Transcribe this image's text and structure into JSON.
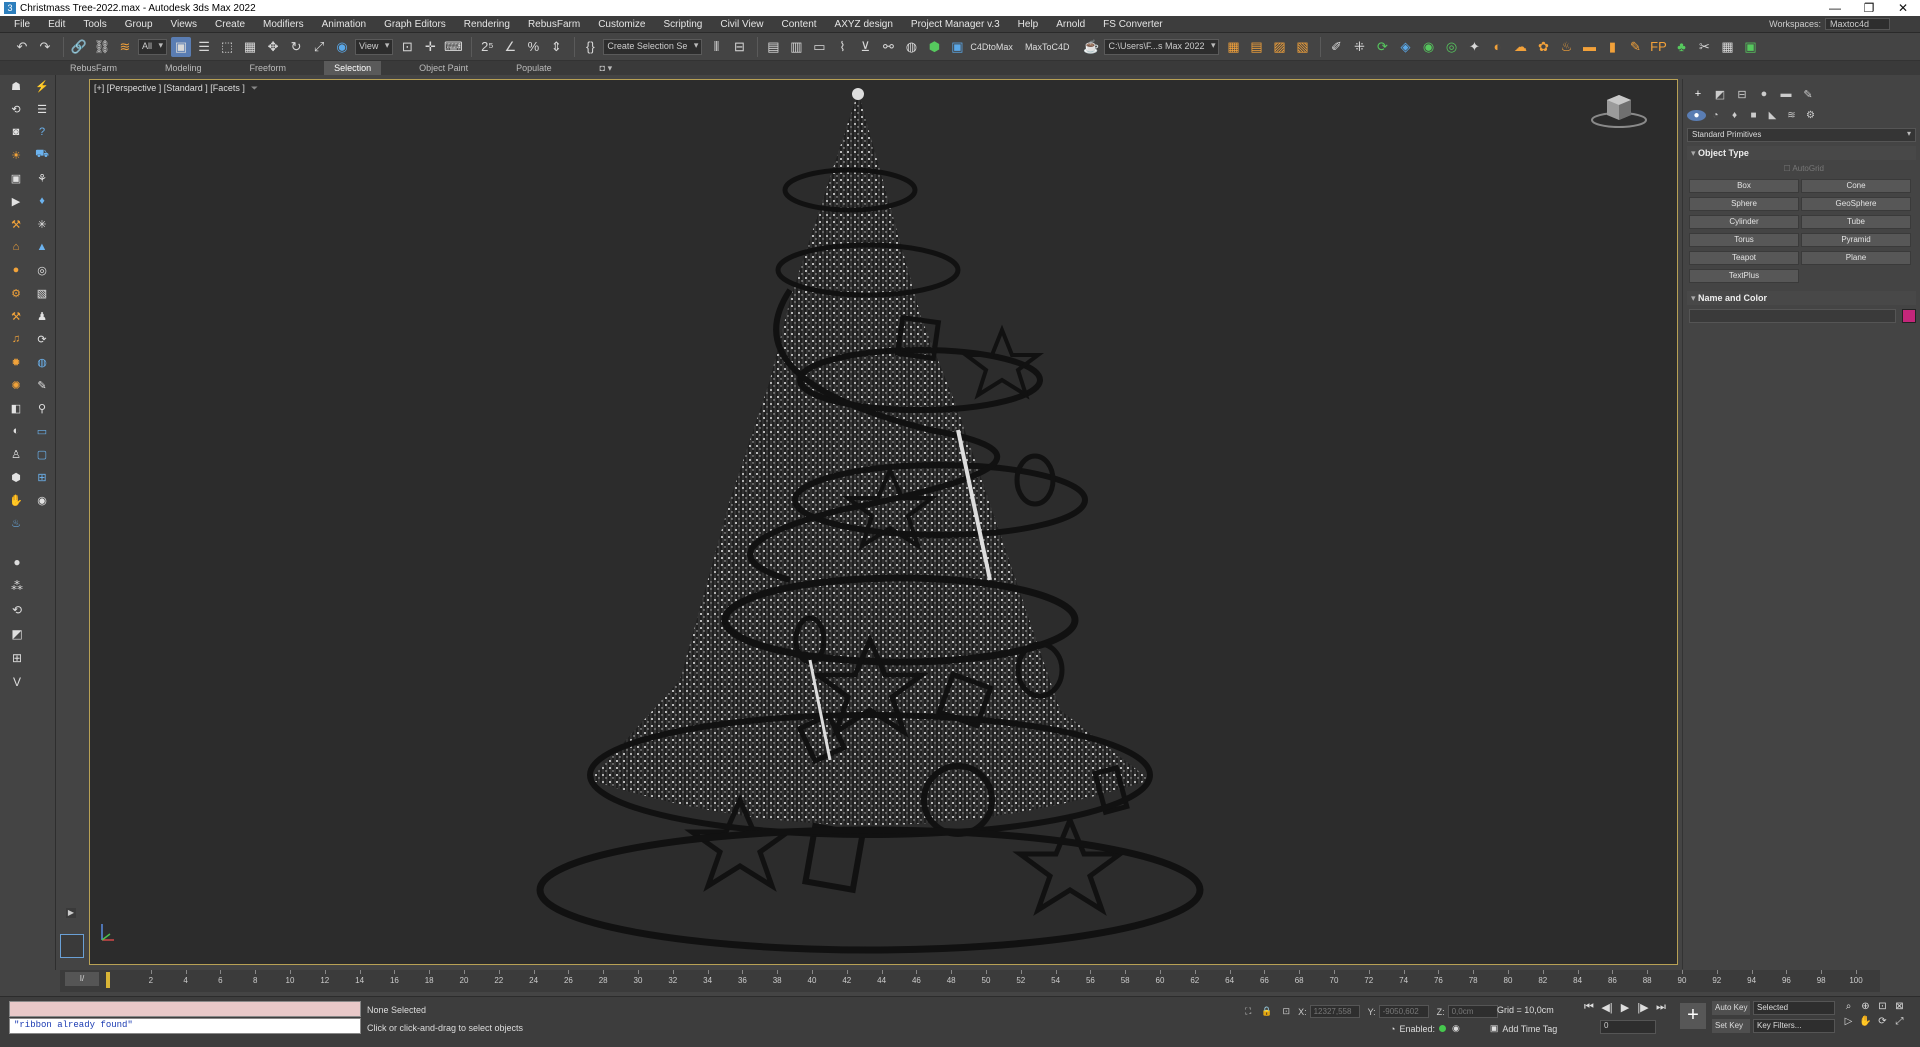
{
  "window": {
    "title": "Christmass Tree-2022.max - Autodesk 3ds Max 2022",
    "controls": [
      "—",
      "❐",
      "✕"
    ]
  },
  "menu": {
    "items": [
      "File",
      "Edit",
      "Tools",
      "Group",
      "Views",
      "Create",
      "Modifiers",
      "Animation",
      "Graph Editors",
      "Rendering",
      "RebusFarm",
      "Customize",
      "Scripting",
      "Civil View",
      "Content",
      "AXYZ design",
      "Project Manager v.3",
      "Help",
      "Arnold",
      "FS Converter"
    ],
    "workspace_label": "Workspaces:",
    "workspace_value": "Maxtoc4d"
  },
  "toolbar": {
    "selection_filter": "All",
    "ref_coord": "View",
    "named_selection": "Create Selection Se",
    "c4d_to_max": "C4DtoMax",
    "max_to_c4d": "MaxToC4D",
    "project_path": "C:\\Users\\F...s Max 2022"
  },
  "ribbon": {
    "tabs": [
      "RebusFarm",
      "Modeling",
      "Freeform",
      "Selection",
      "Object Paint",
      "Populate"
    ],
    "active_tab": "Selection"
  },
  "viewport": {
    "label": "[+] [Perspective ] [Standard ] [Facets ]",
    "filter_icon": "funnel-icon"
  },
  "command_panel": {
    "category": "Standard Primitives",
    "object_type_title": "Object Type",
    "autogrid_label": "AutoGrid",
    "buttons": [
      "Box",
      "Cone",
      "Sphere",
      "GeoSphere",
      "Cylinder",
      "Tube",
      "Torus",
      "Pyramid",
      "Teapot",
      "Plane",
      "TextPlus"
    ],
    "name_color_title": "Name and Color",
    "swatch_color": "#c4267a"
  },
  "timeline": {
    "slider_label": "0 / 100",
    "current_frame": 0,
    "tick_labels": [
      "2",
      "4",
      "6",
      "8",
      "10",
      "12",
      "14",
      "16",
      "18",
      "20",
      "22",
      "24",
      "26",
      "28",
      "30",
      "32",
      "34",
      "36",
      "38",
      "40",
      "42",
      "44",
      "46",
      "48",
      "50",
      "52",
      "54",
      "56",
      "58",
      "60",
      "62",
      "64",
      "66",
      "68",
      "70",
      "72",
      "74",
      "76",
      "78",
      "80",
      "82",
      "84",
      "86",
      "88",
      "90",
      "92",
      "94",
      "96",
      "98",
      "100"
    ]
  },
  "status": {
    "listener_output": "\"ribbon already found\"",
    "selection": "None Selected",
    "prompt": "Click or click-and-drag to select objects",
    "x_label": "X:",
    "x_value": "12327,558",
    "y_label": "Y:",
    "y_value": "-9050,602",
    "z_label": "Z:",
    "z_value": "0,0cm",
    "grid": "Grid = 10,0cm",
    "enabled_label": "Enabled:",
    "add_time_tag": "Add Time Tag",
    "frame_value": "0",
    "auto_key": "Auto Key",
    "set_key": "Set Key",
    "key_mode": "Selected",
    "key_filters": "Key Filters..."
  }
}
